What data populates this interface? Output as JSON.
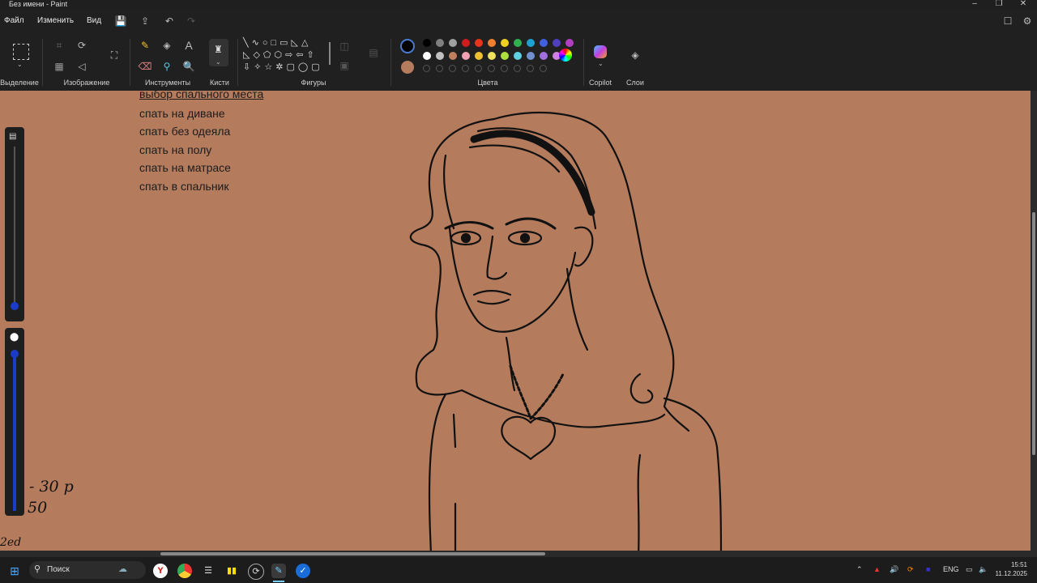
{
  "window": {
    "title": "Без имени - Paint"
  },
  "menu": {
    "file": "Файл",
    "edit": "Изменить",
    "view": "Вид"
  },
  "ribbon": {
    "groups": {
      "selection": "Выделение",
      "image": "Изображение",
      "tools": "Инструменты",
      "brushes": "Кисти",
      "shapes": "Фигуры",
      "colors": "Цвета",
      "copilot": "Copilot",
      "layers": "Слои"
    },
    "primary_color": "#000000",
    "secondary_color": "#b57b5d",
    "palette_row1": [
      "#000000",
      "#808080",
      "#a0a0a0",
      "#d01c1c",
      "#e8341c",
      "#f08030",
      "#f0d020",
      "#30b050",
      "#20a0d0",
      "#4060e0",
      "#5040c0",
      "#b040c0"
    ],
    "palette_row2": [
      "#ffffff",
      "#c0c0c0",
      "#c08060",
      "#f0a0b0",
      "#f0c030",
      "#f0e060",
      "#b0e040",
      "#60d0e0",
      "#7090d0",
      "#a070e0",
      "#d080e0"
    ]
  },
  "canvas": {
    "background": "#b57b5d",
    "notes": [
      "выбор спального места",
      "спать на диване",
      "спать без одеяла",
      "спать на полу",
      "спать на матрасе",
      "спать в спальник"
    ],
    "handwriting": [
      "- 30 р",
      "50"
    ]
  },
  "taskbar": {
    "search_placeholder": "Поиск",
    "language": "ENG",
    "time": "15:51",
    "date": "11.12.2025"
  }
}
